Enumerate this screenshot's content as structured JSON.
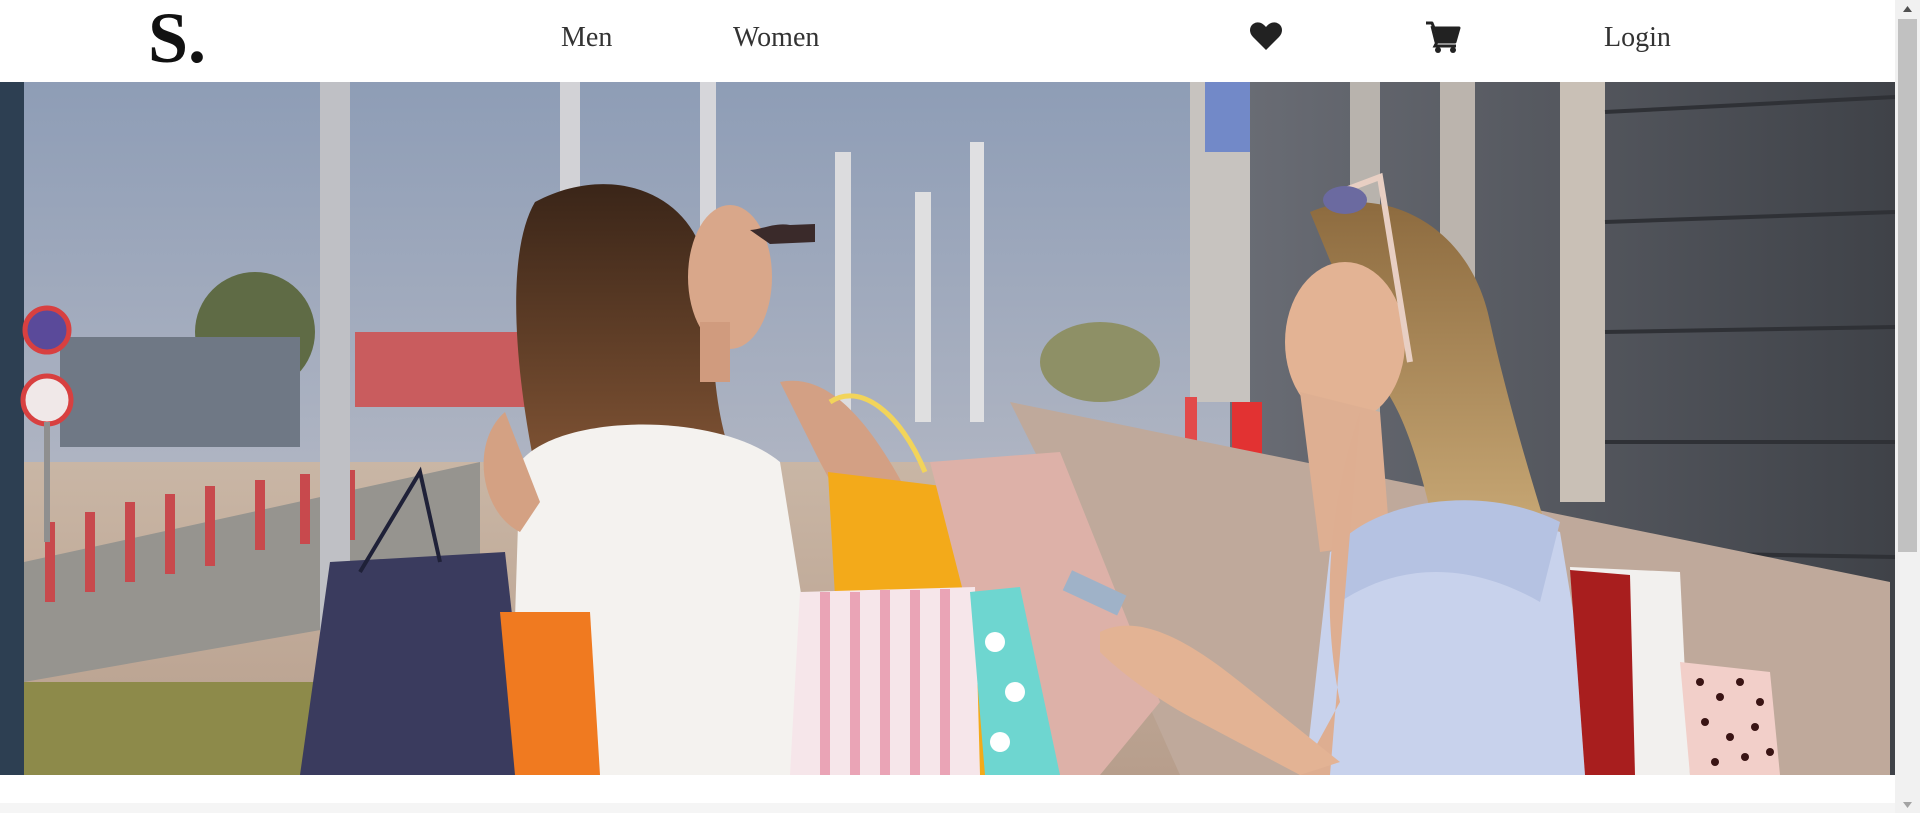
{
  "header": {
    "logo": "S.",
    "nav": {
      "men": "Men",
      "women": "Women",
      "login": "Login"
    },
    "icons": {
      "wishlist": "heart-icon",
      "cart": "cart-icon"
    }
  },
  "hero": {
    "image": "two women with shopping bags talking on a sidewalk"
  },
  "colors": {
    "text": "#333333",
    "logo": "#111111",
    "background": "#ffffff"
  }
}
